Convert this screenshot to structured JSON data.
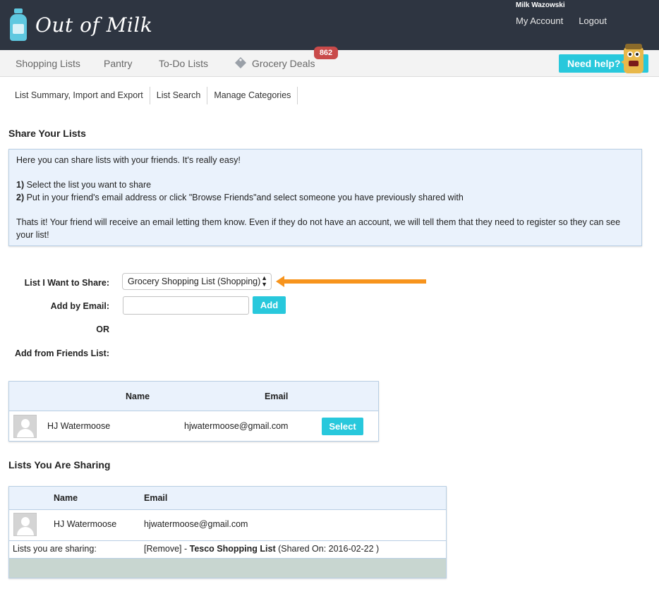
{
  "header": {
    "logo_text": "Out of Milk",
    "user_name": "Milk Wazowski",
    "my_account": "My Account",
    "logout": "Logout"
  },
  "nav": {
    "items": [
      "Shopping Lists",
      "Pantry",
      "To-Do Lists",
      "Grocery Deals"
    ],
    "deals_badge": "862",
    "help_label": "Need help?"
  },
  "subnav": {
    "items": [
      "List Summary, Import and Export",
      "List Search",
      "Manage Categories"
    ]
  },
  "share": {
    "title": "Share Your Lists",
    "info_line1": "Here you can share lists with your friends. It's really easy!",
    "step1_num": "1)",
    "step1_text": " Select the list you want to share",
    "step2_num": "2)",
    "step2_text": " Put in your friend's email address or click \"Browse Friends\"and select someone you have previously shared with",
    "info_last": "Thats it! Your friend will receive an email letting them know. Even if they do not have an account, we will tell them that they need to register so they can see your list!"
  },
  "form": {
    "list_label": "List I Want to Share:",
    "list_selected": "Grocery Shopping List (Shopping)",
    "email_label": "Add by Email:",
    "email_value": "",
    "add_label": "Add",
    "or_label": "OR",
    "friends_label": "Add from Friends List:"
  },
  "friends_table": {
    "headers": [
      "Name",
      "Email"
    ],
    "rows": [
      {
        "name": "HJ Watermoose",
        "email": "hjwatermoose@gmail.com",
        "action": "Select"
      }
    ]
  },
  "sharing": {
    "title": "Lists You Are Sharing",
    "headers": [
      "Name",
      "Email"
    ],
    "rows": [
      {
        "name": "HJ Watermoose",
        "email": "hjwatermoose@gmail.com"
      }
    ],
    "lists_label": "Lists you are sharing:",
    "remove_label": "[Remove]",
    "dash": " - ",
    "list_name": "Tesco Shopping List",
    "shared_on": " (Shared On: 2016-02-22 )"
  },
  "colors": {
    "header_bg": "#2e3541",
    "accent": "#28c8dc",
    "badge": "#c94a4a",
    "arrow": "#f7941d",
    "panel_bg": "#eaf2fc"
  }
}
